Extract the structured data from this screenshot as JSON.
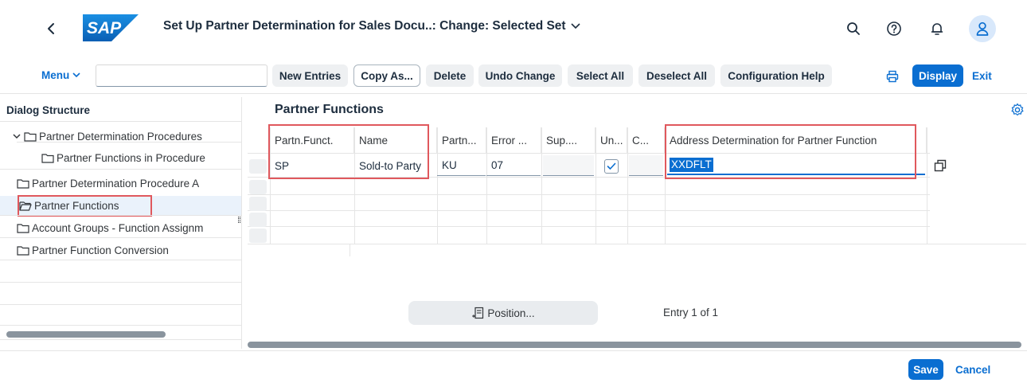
{
  "shell": {
    "logo_text": "SAP",
    "title": "Set Up Partner Determination for Sales Docu..: Change: Selected Set",
    "icons": [
      "back-icon",
      "search-icon",
      "help-icon",
      "bell-icon",
      "user-icon"
    ]
  },
  "toolbar": {
    "menu_label": "Menu",
    "command_field_value": "",
    "buttons": {
      "new_entries": "New Entries",
      "copy_as": "Copy As...",
      "delete": "Delete",
      "undo_change": "Undo Change",
      "select_all": "Select All",
      "deselect_all": "Deselect All",
      "configuration_help": "Configuration Help"
    },
    "display_label": "Display",
    "exit_label": "Exit"
  },
  "dialog_structure": {
    "header": "Dialog Structure",
    "items": [
      {
        "label": "Partner Determination Procedures",
        "expanded": true,
        "selected": false
      },
      {
        "label": "Partner Functions in Procedure",
        "selected": false
      },
      {
        "label": "Partner Determination Procedure A",
        "selected": false
      },
      {
        "label": "Partner Functions",
        "selected": true
      },
      {
        "label": "Account Groups - Function Assignm",
        "selected": false
      },
      {
        "label": "Partner Function Conversion",
        "selected": false
      }
    ]
  },
  "main": {
    "section_title": "Partner Functions",
    "columns": [
      "Partn.Funct.",
      "Name",
      "Partn...",
      "Error ...",
      "Sup....",
      "Un...",
      "C...",
      "Address Determination for Partner Function"
    ],
    "rows": [
      {
        "partn_funct": "SP",
        "name": "Sold-to Party",
        "partner_type": "KU",
        "error": "07",
        "sup": "",
        "unique": true,
        "c": "",
        "address_determination": "XXDFLT"
      }
    ],
    "position_label": "Position...",
    "entry_info": "Entry 1 of 1"
  },
  "footer": {
    "save_label": "Save",
    "cancel_label": "Cancel"
  },
  "colors": {
    "accent": "#0a6ed1",
    "highlight_box": "#e0585d",
    "logo_blue": "#0a6ed1"
  }
}
